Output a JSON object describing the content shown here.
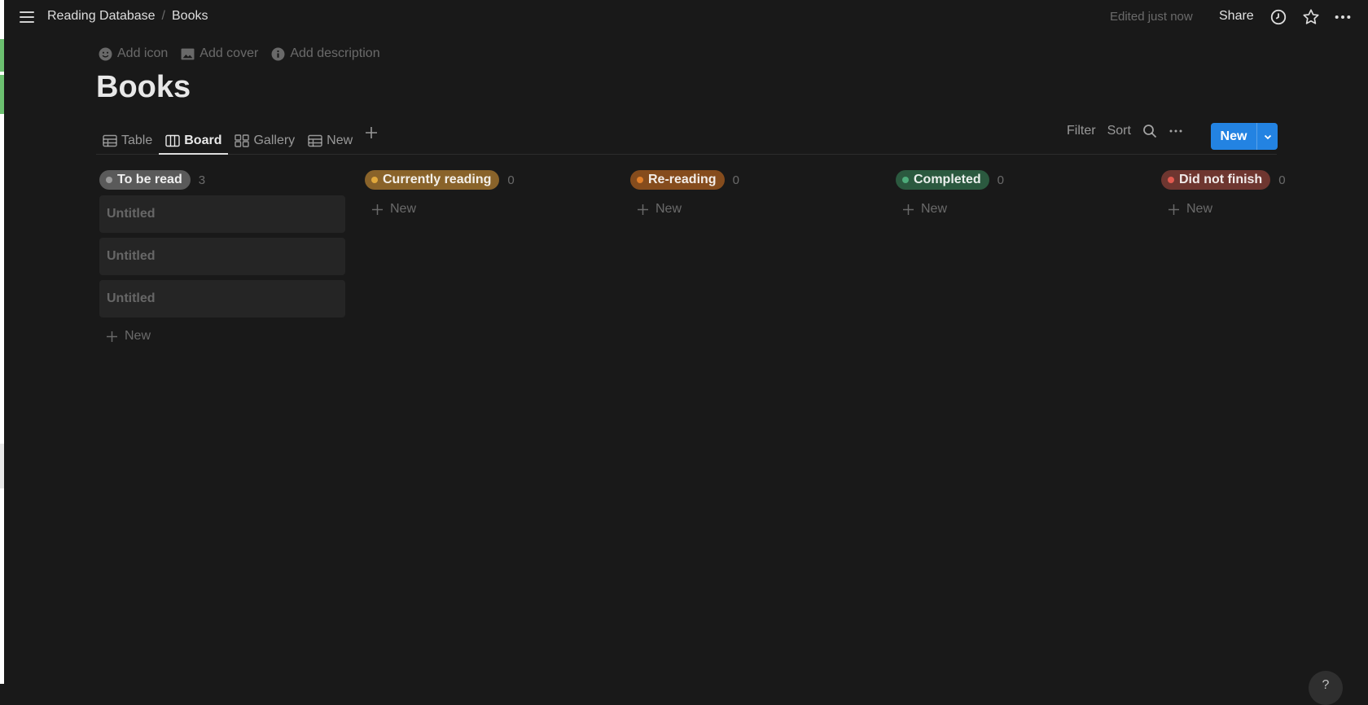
{
  "topbar": {
    "breadcrumb": [
      "Reading Database",
      "Books"
    ],
    "edited": "Edited just now",
    "share": "Share"
  },
  "page": {
    "actions": [
      "Add icon",
      "Add cover",
      "Add description"
    ],
    "title": "Books"
  },
  "views": {
    "tabs": [
      {
        "label": "Table",
        "icon": "table-icon"
      },
      {
        "label": "Board",
        "icon": "board-icon"
      },
      {
        "label": "Gallery",
        "icon": "gallery-icon"
      },
      {
        "label": "New",
        "icon": "table-icon"
      }
    ],
    "active": "Board",
    "tools": {
      "filter": "Filter",
      "sort": "Sort"
    },
    "new_button": "New"
  },
  "board": {
    "columns": [
      {
        "label": "To be read",
        "count": "3",
        "tag_bg": "#5a5a5a",
        "dot": "#9b9b9b",
        "cards": [
          "Untitled",
          "Untitled",
          "Untitled"
        ],
        "new_label": "New"
      },
      {
        "label": "Currently reading",
        "count": "0",
        "tag_bg": "#89632a",
        "dot": "#e0a83c",
        "cards": [],
        "new_label": "New"
      },
      {
        "label": "Re-reading",
        "count": "0",
        "tag_bg": "#854c1d",
        "dot": "#e07f2a",
        "cards": [],
        "new_label": "New"
      },
      {
        "label": "Completed",
        "count": "0",
        "tag_bg": "#2b593f",
        "dot": "#4dab7a",
        "cards": [],
        "new_label": "New"
      },
      {
        "label": "Did not finish",
        "count": "0",
        "tag_bg": "#6e3630",
        "dot": "#e05a4f",
        "cards": [],
        "new_label": "New"
      }
    ]
  },
  "help": "?"
}
